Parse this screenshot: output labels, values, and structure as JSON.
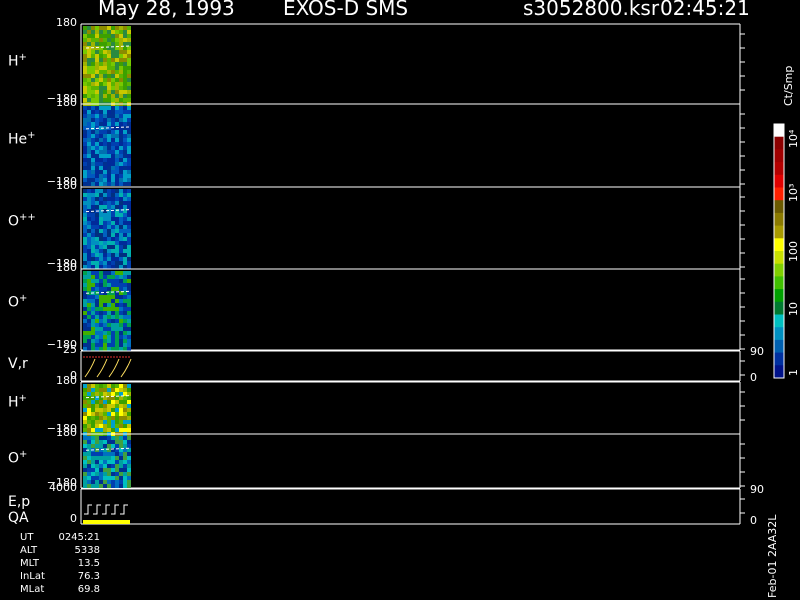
{
  "header": {
    "date": "May 28, 1993",
    "mission": "EXOS-D SMS",
    "filename": "s3052800.ksr",
    "time": "02:45:21"
  },
  "panels": [
    {
      "label": "H",
      "sup": "+",
      "ymax": "180",
      "ymin": "−180"
    },
    {
      "label": "He",
      "sup": "+",
      "ymax": "180",
      "ymin": "−180"
    },
    {
      "label": "O",
      "sup": "++",
      "ymax": "180",
      "ymin": "−180"
    },
    {
      "label": "O",
      "sup": "+",
      "ymax": "180",
      "ymin": "−180"
    },
    {
      "label": "V,r",
      "sup": "",
      "ymax": "25",
      "ymin": "0",
      "rmax": "90",
      "rmin": "0"
    },
    {
      "label": "H",
      "sup": "+",
      "ymax": "180",
      "ymin": "−180"
    },
    {
      "label": "O",
      "sup": "+",
      "ymax": "180",
      "ymin": "−180"
    },
    {
      "label": "E,p",
      "label2": "QA",
      "sup": "",
      "ymax": "4000",
      "ymin": "0",
      "rmax": "90",
      "rmin": "0"
    }
  ],
  "colorbar": {
    "unit": "Ct/Smp",
    "ticks": [
      "10⁴",
      "10³",
      "100",
      "10",
      "1"
    ],
    "colors": [
      "#ffffff",
      "#8b0000",
      "#a00000",
      "#b40000",
      "#e00000",
      "#ff2000",
      "#6b5a00",
      "#8b7a00",
      "#a89a00",
      "#ffff00",
      "#c8e000",
      "#80d000",
      "#40c000",
      "#00a000",
      "#007a30",
      "#00c0c0",
      "#0090c0",
      "#0060b0",
      "#0030a0",
      "#00128a"
    ]
  },
  "footer": {
    "rows": [
      {
        "k": "UT",
        "v": "0245:21"
      },
      {
        "k": "ALT",
        "v": "5338"
      },
      {
        "k": "MLT",
        "v": "13.5"
      },
      {
        "k": "InLat",
        "v": "76.3"
      },
      {
        "k": "MLat",
        "v": "69.8"
      }
    ],
    "stamp": "Feb-01 2AA32L"
  },
  "chart_data": {
    "type": "heatmap",
    "title": "May 28, 1993   EXOS-D SMS",
    "note": "Spectrogram panels (pitch angle -180..180) for H+, He+, O++, O+, H+, O+; line panels V,r and E,p QA",
    "data_coverage_fraction": 0.07,
    "colorscale_unit": "Ct/Smp",
    "colorscale_ticks": [
      "1",
      "10",
      "100",
      "10^3",
      "10^4"
    ]
  }
}
